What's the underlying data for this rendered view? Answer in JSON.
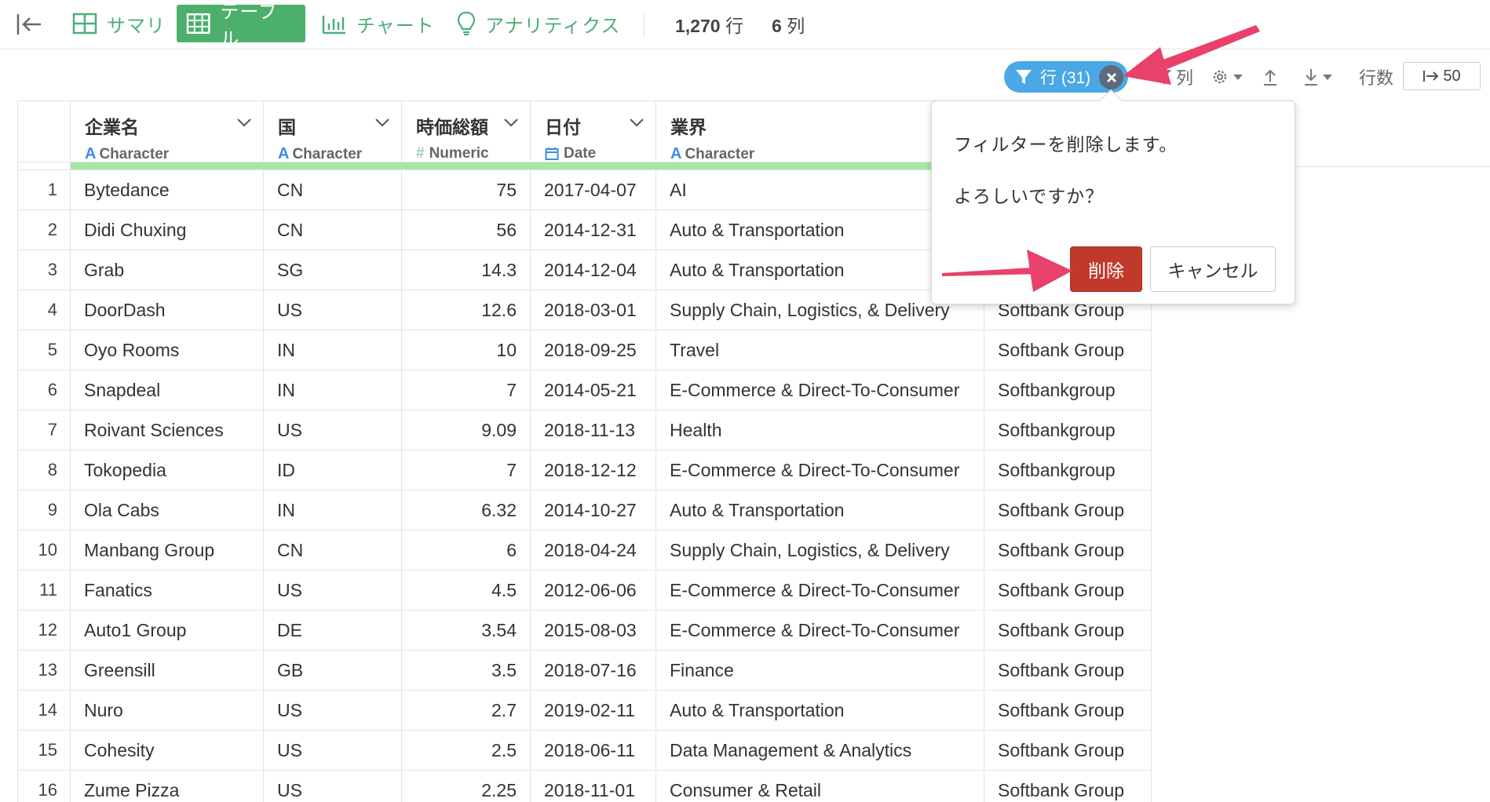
{
  "nav": {
    "collapse_icon": "collapse-left-icon",
    "items": [
      {
        "label": "サマリ",
        "icon": "summary-icon"
      },
      {
        "label": "テーブル",
        "icon": "table-icon",
        "active": true
      },
      {
        "label": "チャート",
        "icon": "chart-icon"
      },
      {
        "label": "アナリティクス",
        "icon": "lightbulb-icon"
      }
    ],
    "rows_count": "1,270",
    "rows_unit": "行",
    "cols_count": "6",
    "cols_unit": "列"
  },
  "toolbar": {
    "filter_label": "行 (31)",
    "column_filter_label": "列",
    "rows_label": "行数",
    "rows_value": "50"
  },
  "columns": [
    {
      "name": "企業名",
      "type": "Character",
      "type_icon": "A"
    },
    {
      "name": "国",
      "type": "Character",
      "type_icon": "A"
    },
    {
      "name": "時価総額",
      "type": "Numeric",
      "type_icon": "#"
    },
    {
      "name": "日付",
      "type": "Date",
      "type_icon": "calendar"
    },
    {
      "name": "業界",
      "type": "Character",
      "type_icon": "A"
    }
  ],
  "rows": [
    {
      "idx": "1",
      "company": "Bytedance",
      "country": "CN",
      "value": "75",
      "date": "2017-04-07",
      "industry": "AI",
      "investor": ""
    },
    {
      "idx": "2",
      "company": "Didi Chuxing",
      "country": "CN",
      "value": "56",
      "date": "2014-12-31",
      "industry": "Auto & Transportation",
      "investor": ""
    },
    {
      "idx": "3",
      "company": "Grab",
      "country": "SG",
      "value": "14.3",
      "date": "2014-12-04",
      "industry": "Auto & Transportation",
      "investor": ""
    },
    {
      "idx": "4",
      "company": "DoorDash",
      "country": "US",
      "value": "12.6",
      "date": "2018-03-01",
      "industry": "Supply Chain, Logistics, & Delivery",
      "investor": "Softbank Group"
    },
    {
      "idx": "5",
      "company": "Oyo Rooms",
      "country": "IN",
      "value": "10",
      "date": "2018-09-25",
      "industry": "Travel",
      "investor": "Softbank Group"
    },
    {
      "idx": "6",
      "company": "Snapdeal",
      "country": "IN",
      "value": "7",
      "date": "2014-05-21",
      "industry": "E-Commerce & Direct-To-Consumer",
      "investor": "Softbankgroup"
    },
    {
      "idx": "7",
      "company": "Roivant Sciences",
      "country": "US",
      "value": "9.09",
      "date": "2018-11-13",
      "industry": "Health",
      "investor": "Softbankgroup"
    },
    {
      "idx": "8",
      "company": "Tokopedia",
      "country": "ID",
      "value": "7",
      "date": "2018-12-12",
      "industry": "E-Commerce & Direct-To-Consumer",
      "investor": "Softbankgroup"
    },
    {
      "idx": "9",
      "company": "Ola Cabs",
      "country": "IN",
      "value": "6.32",
      "date": "2014-10-27",
      "industry": "Auto & Transportation",
      "investor": "Softbank Group"
    },
    {
      "idx": "10",
      "company": "Manbang Group",
      "country": "CN",
      "value": "6",
      "date": "2018-04-24",
      "industry": "Supply Chain, Logistics, & Delivery",
      "investor": "Softbank Group"
    },
    {
      "idx": "11",
      "company": "Fanatics",
      "country": "US",
      "value": "4.5",
      "date": "2012-06-06",
      "industry": "E-Commerce & Direct-To-Consumer",
      "investor": "Softbank Group"
    },
    {
      "idx": "12",
      "company": "Auto1 Group",
      "country": "DE",
      "value": "3.54",
      "date": "2015-08-03",
      "industry": "E-Commerce & Direct-To-Consumer",
      "investor": "Softbank Group"
    },
    {
      "idx": "13",
      "company": "Greensill",
      "country": "GB",
      "value": "3.5",
      "date": "2018-07-16",
      "industry": "Finance",
      "investor": "Softbank Group"
    },
    {
      "idx": "14",
      "company": "Nuro",
      "country": "US",
      "value": "2.7",
      "date": "2019-02-11",
      "industry": "Auto & Transportation",
      "investor": "Softbank Group"
    },
    {
      "idx": "15",
      "company": "Cohesity",
      "country": "US",
      "value": "2.5",
      "date": "2018-06-11",
      "industry": "Data Management & Analytics",
      "investor": "Softbank Group"
    },
    {
      "idx": "16",
      "company": "Zume Pizza",
      "country": "US",
      "value": "2.25",
      "date": "2018-11-01",
      "industry": "Consumer & Retail",
      "investor": "Softbank Group"
    }
  ],
  "popover": {
    "message": "フィルターを削除します。",
    "confirm": "よろしいですか？",
    "delete_label": "削除",
    "cancel_label": "キャンセル"
  },
  "colors": {
    "accent_green": "#4caf6c",
    "filter_blue": "#4aa8e6",
    "delete_red": "#c0392b",
    "annotation_arrow": "#e8416b"
  }
}
